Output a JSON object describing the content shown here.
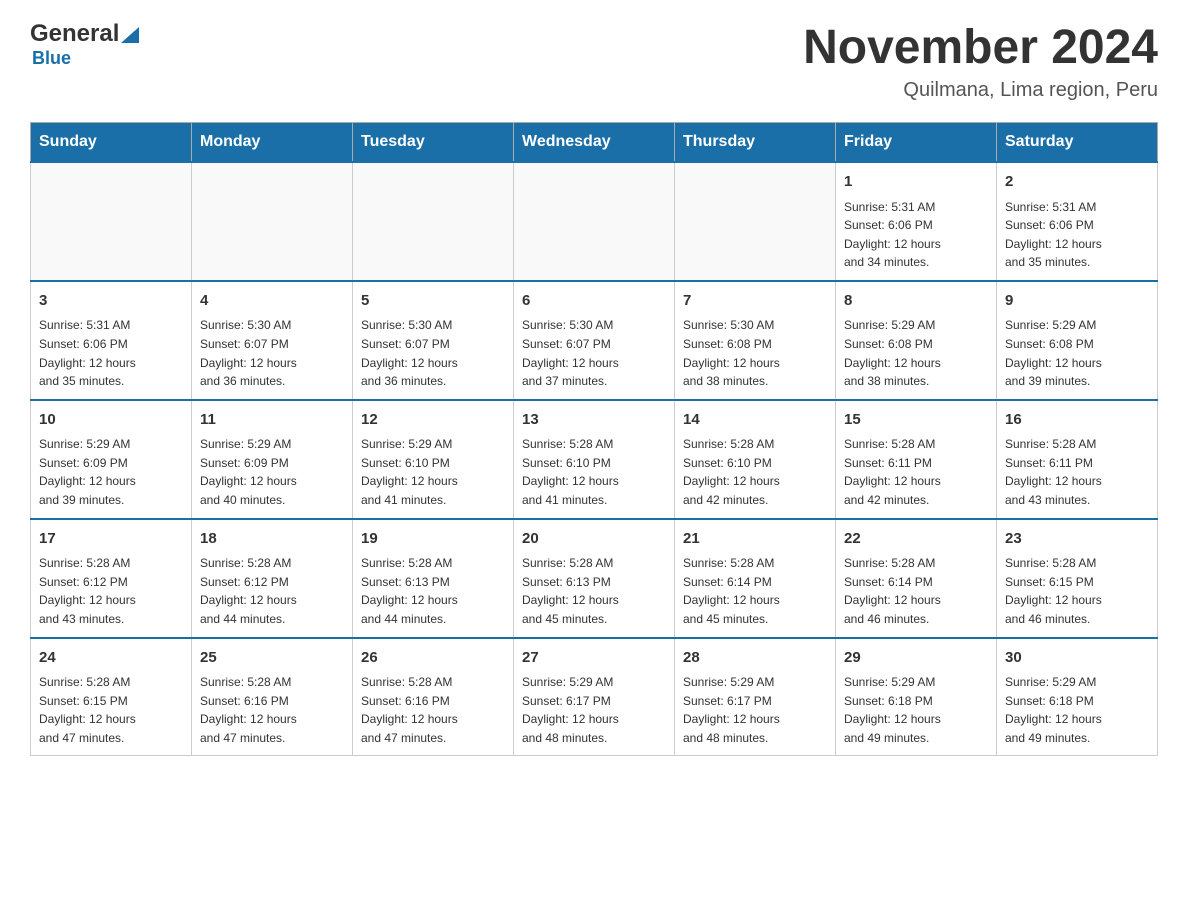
{
  "header": {
    "logo": {
      "general": "General",
      "blue": "Blue",
      "arrow_unicode": "▶"
    },
    "title": "November 2024",
    "subtitle": "Quilmana, Lima region, Peru"
  },
  "weekdays": [
    "Sunday",
    "Monday",
    "Tuesday",
    "Wednesday",
    "Thursday",
    "Friday",
    "Saturday"
  ],
  "weeks": [
    [
      {
        "day": "",
        "info": ""
      },
      {
        "day": "",
        "info": ""
      },
      {
        "day": "",
        "info": ""
      },
      {
        "day": "",
        "info": ""
      },
      {
        "day": "",
        "info": ""
      },
      {
        "day": "1",
        "info": "Sunrise: 5:31 AM\nSunset: 6:06 PM\nDaylight: 12 hours\nand 34 minutes."
      },
      {
        "day": "2",
        "info": "Sunrise: 5:31 AM\nSunset: 6:06 PM\nDaylight: 12 hours\nand 35 minutes."
      }
    ],
    [
      {
        "day": "3",
        "info": "Sunrise: 5:31 AM\nSunset: 6:06 PM\nDaylight: 12 hours\nand 35 minutes."
      },
      {
        "day": "4",
        "info": "Sunrise: 5:30 AM\nSunset: 6:07 PM\nDaylight: 12 hours\nand 36 minutes."
      },
      {
        "day": "5",
        "info": "Sunrise: 5:30 AM\nSunset: 6:07 PM\nDaylight: 12 hours\nand 36 minutes."
      },
      {
        "day": "6",
        "info": "Sunrise: 5:30 AM\nSunset: 6:07 PM\nDaylight: 12 hours\nand 37 minutes."
      },
      {
        "day": "7",
        "info": "Sunrise: 5:30 AM\nSunset: 6:08 PM\nDaylight: 12 hours\nand 38 minutes."
      },
      {
        "day": "8",
        "info": "Sunrise: 5:29 AM\nSunset: 6:08 PM\nDaylight: 12 hours\nand 38 minutes."
      },
      {
        "day": "9",
        "info": "Sunrise: 5:29 AM\nSunset: 6:08 PM\nDaylight: 12 hours\nand 39 minutes."
      }
    ],
    [
      {
        "day": "10",
        "info": "Sunrise: 5:29 AM\nSunset: 6:09 PM\nDaylight: 12 hours\nand 39 minutes."
      },
      {
        "day": "11",
        "info": "Sunrise: 5:29 AM\nSunset: 6:09 PM\nDaylight: 12 hours\nand 40 minutes."
      },
      {
        "day": "12",
        "info": "Sunrise: 5:29 AM\nSunset: 6:10 PM\nDaylight: 12 hours\nand 41 minutes."
      },
      {
        "day": "13",
        "info": "Sunrise: 5:28 AM\nSunset: 6:10 PM\nDaylight: 12 hours\nand 41 minutes."
      },
      {
        "day": "14",
        "info": "Sunrise: 5:28 AM\nSunset: 6:10 PM\nDaylight: 12 hours\nand 42 minutes."
      },
      {
        "day": "15",
        "info": "Sunrise: 5:28 AM\nSunset: 6:11 PM\nDaylight: 12 hours\nand 42 minutes."
      },
      {
        "day": "16",
        "info": "Sunrise: 5:28 AM\nSunset: 6:11 PM\nDaylight: 12 hours\nand 43 minutes."
      }
    ],
    [
      {
        "day": "17",
        "info": "Sunrise: 5:28 AM\nSunset: 6:12 PM\nDaylight: 12 hours\nand 43 minutes."
      },
      {
        "day": "18",
        "info": "Sunrise: 5:28 AM\nSunset: 6:12 PM\nDaylight: 12 hours\nand 44 minutes."
      },
      {
        "day": "19",
        "info": "Sunrise: 5:28 AM\nSunset: 6:13 PM\nDaylight: 12 hours\nand 44 minutes."
      },
      {
        "day": "20",
        "info": "Sunrise: 5:28 AM\nSunset: 6:13 PM\nDaylight: 12 hours\nand 45 minutes."
      },
      {
        "day": "21",
        "info": "Sunrise: 5:28 AM\nSunset: 6:14 PM\nDaylight: 12 hours\nand 45 minutes."
      },
      {
        "day": "22",
        "info": "Sunrise: 5:28 AM\nSunset: 6:14 PM\nDaylight: 12 hours\nand 46 minutes."
      },
      {
        "day": "23",
        "info": "Sunrise: 5:28 AM\nSunset: 6:15 PM\nDaylight: 12 hours\nand 46 minutes."
      }
    ],
    [
      {
        "day": "24",
        "info": "Sunrise: 5:28 AM\nSunset: 6:15 PM\nDaylight: 12 hours\nand 47 minutes."
      },
      {
        "day": "25",
        "info": "Sunrise: 5:28 AM\nSunset: 6:16 PM\nDaylight: 12 hours\nand 47 minutes."
      },
      {
        "day": "26",
        "info": "Sunrise: 5:28 AM\nSunset: 6:16 PM\nDaylight: 12 hours\nand 47 minutes."
      },
      {
        "day": "27",
        "info": "Sunrise: 5:29 AM\nSunset: 6:17 PM\nDaylight: 12 hours\nand 48 minutes."
      },
      {
        "day": "28",
        "info": "Sunrise: 5:29 AM\nSunset: 6:17 PM\nDaylight: 12 hours\nand 48 minutes."
      },
      {
        "day": "29",
        "info": "Sunrise: 5:29 AM\nSunset: 6:18 PM\nDaylight: 12 hours\nand 49 minutes."
      },
      {
        "day": "30",
        "info": "Sunrise: 5:29 AM\nSunset: 6:18 PM\nDaylight: 12 hours\nand 49 minutes."
      }
    ]
  ]
}
